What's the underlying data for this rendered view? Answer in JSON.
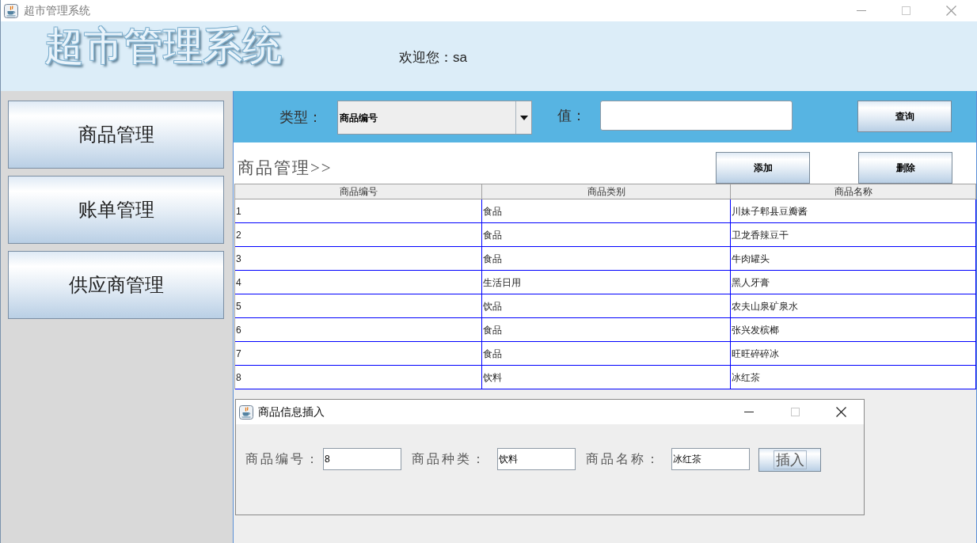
{
  "window": {
    "title": "超市管理系统"
  },
  "header": {
    "logo": "超市管理系统",
    "welcome": "欢迎您：sa"
  },
  "sidebar": {
    "items": [
      "商品管理",
      "账单管理",
      "供应商管理"
    ]
  },
  "search_bar": {
    "type_label": "类型：",
    "type_value": "商品编号",
    "value_label": "值：",
    "search_button": "查询"
  },
  "section": {
    "title": "商品管理>>",
    "buttons": [
      "添加",
      "删除"
    ]
  },
  "table": {
    "columns": [
      "商品编号",
      "商品类别",
      "商品名称"
    ],
    "rows": [
      [
        "1",
        "食品",
        "川妹子郫县豆瓣酱"
      ],
      [
        "2",
        "食品",
        "卫龙香辣豆干"
      ],
      [
        "3",
        "食品",
        "牛肉罐头"
      ],
      [
        "4",
        "生活日用",
        "黑人牙膏"
      ],
      [
        "5",
        "饮品",
        "农夫山泉矿泉水"
      ],
      [
        "6",
        "食品",
        "张兴发槟榔"
      ],
      [
        "7",
        "食品",
        "旺旺碎碎冰"
      ],
      [
        "8",
        "饮料",
        "冰红茶"
      ]
    ]
  },
  "dialog": {
    "title": "商品信息插入",
    "fields": [
      {
        "label": "商品编号：",
        "value": "8"
      },
      {
        "label": "商品种类：",
        "value": "饮料"
      },
      {
        "label": "商品名称：",
        "value": "冰红茶"
      }
    ],
    "button": "插入"
  }
}
